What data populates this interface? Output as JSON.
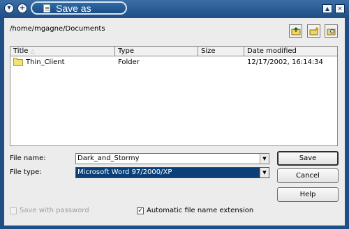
{
  "window": {
    "title": "Save as"
  },
  "current_path": "/home/mgagne/Documents",
  "toolbar": {
    "icons": [
      "up-folder-icon",
      "new-folder-icon",
      "browse-icon"
    ]
  },
  "file_list": {
    "columns": [
      "Title",
      "Type",
      "Size",
      "Date modified"
    ],
    "rows": [
      {
        "title": "Thin_Client",
        "type": "Folder",
        "size": "",
        "date_modified": "12/17/2002, 16:14:34"
      }
    ]
  },
  "form": {
    "file_name_label": "File name:",
    "file_name_value": "Dark_and_Stormy",
    "file_type_label": "File type:",
    "file_type_value": "Microsoft Word 97/2000/XP"
  },
  "buttons": {
    "save": "Save",
    "cancel": "Cancel",
    "help": "Help"
  },
  "options": {
    "save_with_password": {
      "label": "Save with password",
      "checked": false,
      "enabled": false
    },
    "automatic_extension": {
      "label": "Automatic file name extension",
      "checked": true
    }
  },
  "colors": {
    "titlebar": "#1d4f86",
    "selection": "#0a3f78",
    "dialog_bg": "#ececec"
  }
}
